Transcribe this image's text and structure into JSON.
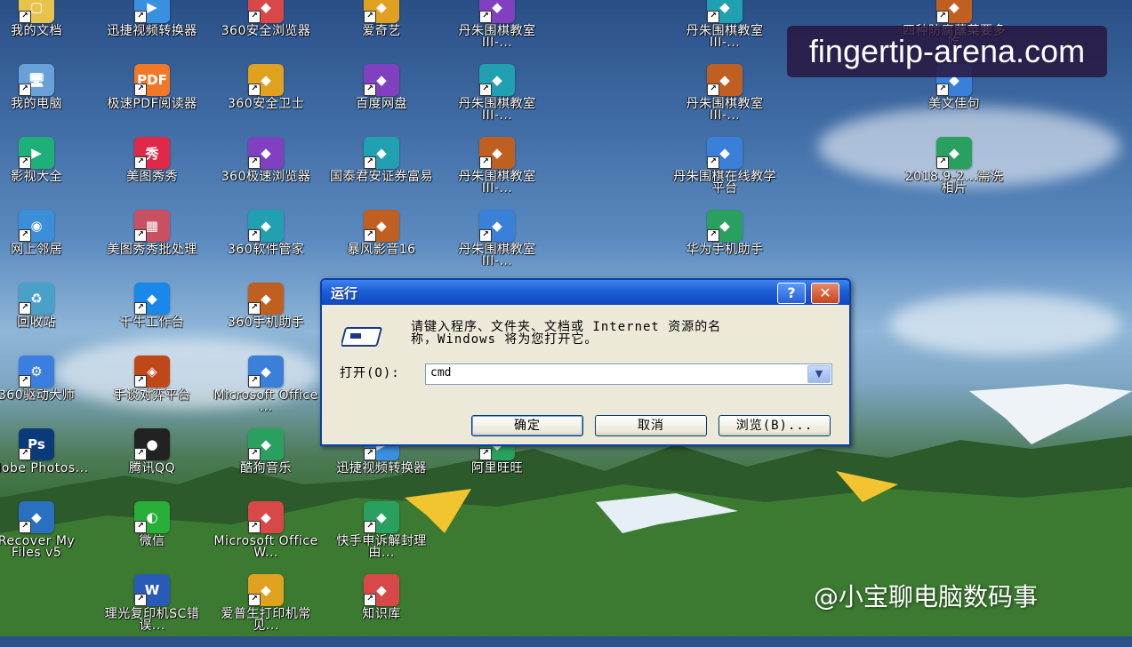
{
  "desktop": {
    "col1": [
      "我的文档",
      "我的电脑",
      "影视大全",
      "网上邻居",
      "回收站",
      "360驱动大师",
      "Adobe Photos...",
      "Recover My Files v5"
    ],
    "col2": [
      "迅捷视频转换器",
      "极速PDF阅读器",
      "美图秀秀",
      "美图秀秀批处理",
      "千牛工作台",
      "手谈对弈平台",
      "腾讯QQ",
      "微信",
      "理光复印机SC错误..."
    ],
    "col3": [
      "360安全浏览器",
      "360安全卫士",
      "360极速浏览器",
      "360软件管家",
      "360手机助手",
      "Microsoft Office ...",
      "酷狗音乐",
      "Microsoft Office W...",
      "爱普生打印机常见..."
    ],
    "col4": [
      "爱奇艺",
      "百度网盘",
      "国泰君安证券富易",
      "暴风影音16",
      "迅捷视频转换器",
      "快手申诉解封理由...",
      "知识库"
    ],
    "col5": [
      "丹朱围棋教室III-...",
      "丹朱围棋教室III-...",
      "丹朱围棋教室III-...",
      "丹朱围棋教室III-...",
      "阿里旺旺"
    ],
    "col6": [
      "丹朱围棋教室III-...",
      "丹朱围棋教室III-...",
      "丹朱围棋在线教学平台",
      "华为手机助手"
    ],
    "col7": [
      "四种防腐蘸菜要多吃",
      "美文佳句",
      "2018.9-2...需洗相片"
    ]
  },
  "icons": {
    "colors": {
      "我的文档": "#e8c24a",
      "我的电脑": "#6aa0d8",
      "影视大全": "#1fb07a",
      "网上邻居": "#3a8fd8",
      "回收站": "#4aa0c8",
      "360驱动大师": "#3a7fe0",
      "Adobe Photos...": "#0a3a78",
      "Recover My Files v5": "#2a70c0",
      "迅捷视频转换器": "#3a90e0",
      "极速PDF阅读器": "#f07828",
      "美图秀秀": "#e02848",
      "美图秀秀批处理": "#c85060",
      "千牛工作台": "#1a88e8",
      "手谈对弈平台": "#c04818",
      "腾讯QQ": "#222222",
      "微信": "#2aae3a",
      "理光复印机SC错误...": "#2a5ab8"
    },
    "glyphs": {
      "我的文档": "▢",
      "我的电脑": "🖥",
      "影视大全": "▶",
      "网上邻居": "◉",
      "回收站": "♻",
      "360驱动大师": "⚙",
      "Adobe Photos...": "Ps",
      "Recover My Files v5": "◆",
      "迅捷视频转换器": "▶",
      "极速PDF阅读器": "PDF",
      "美图秀秀": "秀",
      "美图秀秀批处理": "▦",
      "千牛工作台": "◆",
      "手谈对弈平台": "◈",
      "腾讯QQ": "●",
      "微信": "◐",
      "理光复印机SC错误...": "W"
    }
  },
  "watermark": {
    "top": "fingertip-arena.com",
    "bottom": "@小宝聊电脑数码事"
  },
  "dialog": {
    "title": "运行",
    "help": "?",
    "close": "✕",
    "prompt_line1": "请键入程序、文件夹、文档或 Internet 资源的名",
    "prompt_line2": "称，Windows 将为您打开它。",
    "open_label": "打开(O):",
    "open_value": "cmd",
    "ok": "确定",
    "cancel": "取消",
    "browse": "浏览(B)..."
  }
}
